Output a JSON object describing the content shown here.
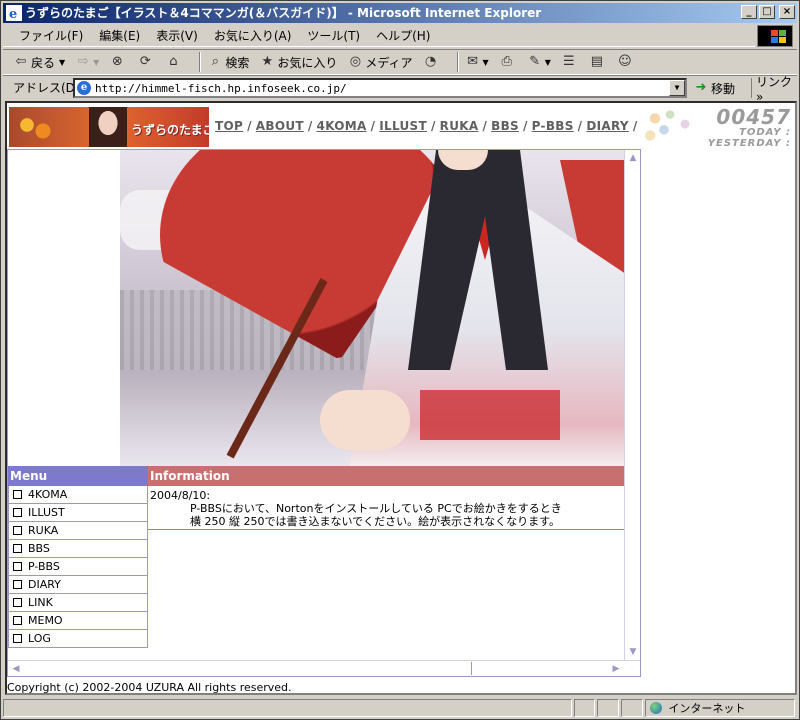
{
  "window": {
    "title": "うずらのたまご【イラスト＆4コママンガ(＆バスガイド)】 - Microsoft Internet Explorer"
  },
  "menubar": {
    "items": [
      "ファイル(F)",
      "編集(E)",
      "表示(V)",
      "お気に入り(A)",
      "ツール(T)",
      "ヘルプ(H)"
    ]
  },
  "toolbar": {
    "back": "戻る",
    "search": "検索",
    "favorites": "お気に入り",
    "media": "メディア"
  },
  "addressbar": {
    "label": "アドレス(D)",
    "url": "http://himmel-fisch.hp.infoseek.co.jp/",
    "go": "移動",
    "links": "リンク »"
  },
  "page": {
    "logo_text": "うずらのたまご",
    "nav": [
      "TOP",
      "ABOUT",
      "4KOMA",
      "ILLUST",
      "RUKA",
      "BBS",
      "P-BBS",
      "DIARY"
    ],
    "counter": {
      "value": "00457",
      "today_label": "TODAY :",
      "yesterday_label": "YESTERDAY :"
    },
    "menu": {
      "title": "Menu",
      "items": [
        "4KOMA",
        "ILLUST",
        "RUKA",
        "BBS",
        "P-BBS",
        "DIARY",
        "LINK",
        "MEMO",
        "LOG"
      ]
    },
    "information": {
      "title": "Information",
      "date": "2004/8/10:",
      "line1": "P-BBSにおいて、Nortonをインストールしている PCでお絵かきをするとき",
      "line2": "横 250 縦 250では書き込まないでください。絵が表示されなくなります。"
    },
    "copyright": "Copyright (c) 2002-2004 UZURA All rights reserved."
  },
  "statusbar": {
    "zone": "インターネット"
  }
}
